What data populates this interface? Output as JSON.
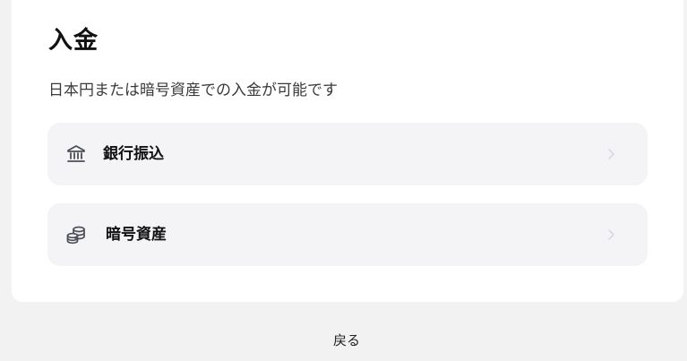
{
  "page": {
    "title": "入金",
    "subtitle": "日本円または暗号資産での入金が可能です"
  },
  "options": [
    {
      "label": "銀行振込",
      "icon": "bank-icon"
    },
    {
      "label": "暗号資産",
      "icon": "coins-icon"
    }
  ],
  "footer": {
    "back_label": "戻る"
  },
  "colors": {
    "background": "#f2f2f2",
    "card": "#ffffff",
    "option_background": "#f4f4f6",
    "icon": "#4a4e57",
    "chevron": "#d9d9de"
  }
}
